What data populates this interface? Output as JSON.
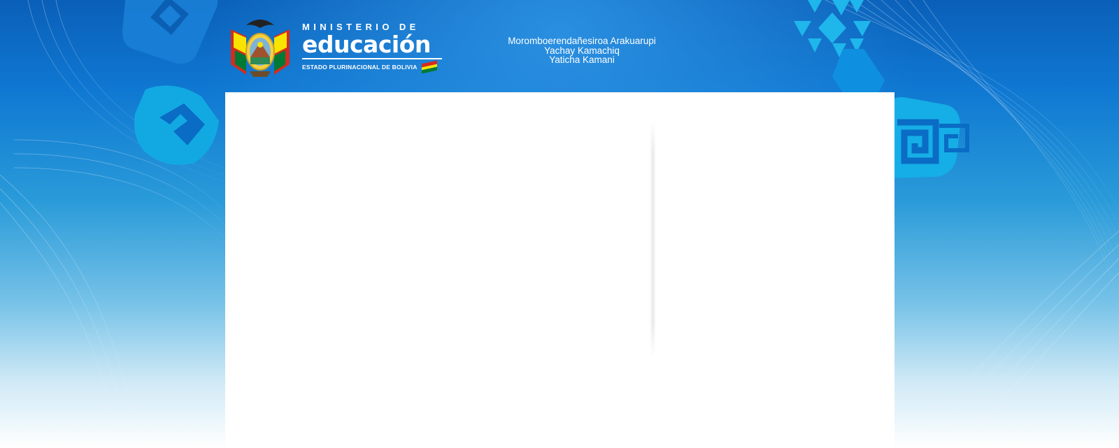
{
  "header": {
    "logo": {
      "ministry_line": "MINISTERIO DE",
      "wordmark": "educación",
      "subtitle": "ESTADO PLURINACIONAL DE BOLIVIA",
      "emblem": "bolivia-coat-of-arms-icon"
    },
    "tagline": [
      "Moromboerendañesiroa Arakuarupi",
      "Yachay Kamachiq",
      "Yaticha Kamani"
    ]
  },
  "colors": {
    "background_top": "#0a5fb8",
    "background_bottom": "#ffffff",
    "panel": "#ffffff",
    "flag_red": "#d52b1e",
    "flag_yellow": "#f9e300",
    "flag_green": "#007934",
    "decor_cyan": "#17b6e8"
  }
}
